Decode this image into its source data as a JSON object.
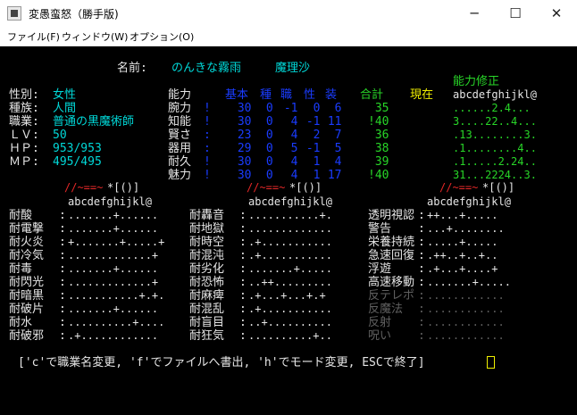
{
  "window": {
    "title": "変愚蛮怒（勝手版)",
    "minimize": "─",
    "maximize": "☐",
    "close": "✕"
  },
  "menu": [
    "ファイル(F)",
    "ウィンドウ(W)",
    "オプション(O)"
  ],
  "character": {
    "name_label": "名前:",
    "nickname": "のんきな霧雨",
    "name": "魔理沙",
    "sex_label": "性別:",
    "sex": "女性",
    "race_label": "種族:",
    "race": "人間",
    "class_label": "職業:",
    "class": "普通の黒魔術師",
    "lv_label": "ＬＶ:",
    "lv": "50",
    "hp_label": "ＨＰ:",
    "hp": "953/953",
    "mp_label": "ＭＰ:",
    "mp": "495/495"
  },
  "stats": {
    "header": {
      "ability": "能力",
      "base": "基本",
      "race": "種",
      "class": "職",
      "personality": "性",
      "equip": "装",
      "total": "合計",
      "current": "現在",
      "modifier_title": "能力修正",
      "modifier_letters": "abcdefghijkl@"
    },
    "rows": [
      {
        "name": "腕力",
        "sep": "!",
        "base": "30",
        "r": "0",
        "c": "-1",
        "p": "0",
        "e": "6",
        "total": "35",
        "mods": "......2.4..."
      },
      {
        "name": "知能",
        "sep": "!",
        "base": "30",
        "r": "0",
        "c": "4",
        "p": "-1",
        "e": "11",
        "total": "!40",
        "mods": "3....22..4..."
      },
      {
        "name": "賢さ",
        "sep": ":",
        "base": "23",
        "r": "0",
        "c": "4",
        "p": "2",
        "e": "7",
        "total": "36",
        "mods": ".13........3."
      },
      {
        "name": "器用",
        "sep": ":",
        "base": "29",
        "r": "0",
        "c": "5",
        "p": "-1",
        "e": "5",
        "total": "38",
        "mods": ".1........4.."
      },
      {
        "name": "耐久",
        "sep": "!",
        "base": "30",
        "r": "0",
        "c": "4",
        "p": "1",
        "e": "4",
        "total": "39",
        "mods": ".1.....2.24.."
      },
      {
        "name": "魅力",
        "sep": "!",
        "base": "30",
        "r": "0",
        "c": "4",
        "p": "1",
        "e": "17",
        "total": "!40",
        "mods": "31...2224..3."
      }
    ]
  },
  "resist": {
    "equip_header": "//~==~*[()]",
    "letters": "abcdefghijkl@",
    "col1": [
      {
        "label": "耐酸",
        "sep": ":",
        "marks": ".......+......"
      },
      {
        "label": "耐電撃",
        "sep": ":",
        "marks": ".......+......"
      },
      {
        "label": "耐火炎",
        "sep": ":",
        "marks": "+.......+.....+"
      },
      {
        "label": "耐冷気",
        "sep": ":",
        "marks": ".............+"
      },
      {
        "label": "耐毒",
        "sep": ":",
        "marks": ".......+......"
      },
      {
        "label": "耐閃光",
        "sep": ":",
        "marks": ".............+"
      },
      {
        "label": "耐暗黒",
        "sep": ":",
        "marks": "...........+.+."
      },
      {
        "label": "耐破片",
        "sep": ":",
        "marks": ".......+......"
      },
      {
        "label": "耐水",
        "sep": ":",
        "marks": "..........+...."
      },
      {
        "label": "耐破邪",
        "sep": ":",
        "marks": ".+............"
      }
    ],
    "col2": [
      {
        "label": "耐轟音",
        "sep": ":",
        "marks": "...........+."
      },
      {
        "label": "耐地獄",
        "sep": ":",
        "marks": "............."
      },
      {
        "label": "耐時空",
        "sep": ":",
        "marks": ".+..........."
      },
      {
        "label": "耐混沌",
        "sep": ":",
        "marks": ".+..........."
      },
      {
        "label": "耐劣化",
        "sep": ":",
        "marks": ".......+....."
      },
      {
        "label": "耐恐怖",
        "sep": ":",
        "marks": "..++........."
      },
      {
        "label": "耐麻痺",
        "sep": ":",
        "marks": ".+...+...+.+"
      },
      {
        "label": "耐混乱",
        "sep": ":",
        "marks": ".+..........."
      },
      {
        "label": "耐盲目",
        "sep": ":",
        "marks": "..+.........."
      },
      {
        "label": "耐狂気",
        "sep": ":",
        "marks": "..........+.."
      }
    ],
    "col3": [
      {
        "label": "透明視認",
        "sep": ":",
        "marks": "++...+....."
      },
      {
        "label": "警告",
        "sep": ":",
        "marks": "...+........"
      },
      {
        "label": "栄養持続",
        "sep": ":",
        "marks": ".....+....."
      },
      {
        "label": "急速回復",
        "sep": ":",
        "marks": ".++..+..+.."
      },
      {
        "label": "浮遊",
        "sep": ":",
        "marks": ".+...+....+"
      },
      {
        "label": "高速移動",
        "sep": ":",
        "marks": ".......+....."
      },
      {
        "label": "反テレポ",
        "sep": ":",
        "marks": "............"
      },
      {
        "label": "反魔法",
        "sep": ":",
        "marks": "............"
      },
      {
        "label": "反射",
        "sep": ":",
        "marks": "............"
      },
      {
        "label": "呪い",
        "sep": ":",
        "marks": "............"
      }
    ]
  },
  "footer": "['c'で職業名変更, 'f'でファイルへ書出, 'h'でモード変更, ESCで終了]"
}
